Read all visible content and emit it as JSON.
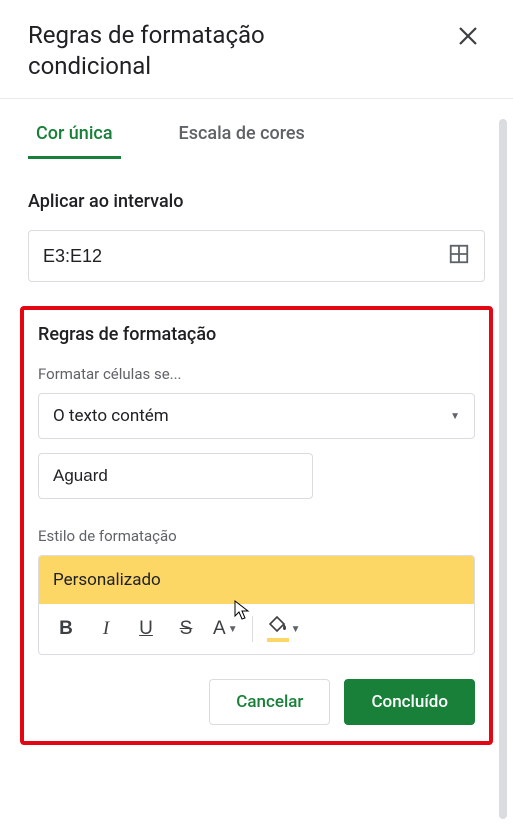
{
  "panel": {
    "title": "Regras de formatação condicional",
    "tabs": {
      "single_color": "Cor única",
      "color_scale": "Escala de cores"
    },
    "apply_range": {
      "label": "Aplicar ao intervalo",
      "value": "E3:E12"
    },
    "format_rules": {
      "title": "Regras de formatação",
      "format_cells_if_label": "Formatar células se...",
      "condition_selected": "O texto contém",
      "condition_value": "Aguard"
    },
    "format_style": {
      "label": "Estilo de formatação",
      "preview": "Personalizado",
      "highlight_color": "#fdd766"
    },
    "buttons": {
      "cancel": "Cancelar",
      "done": "Concluído"
    }
  }
}
